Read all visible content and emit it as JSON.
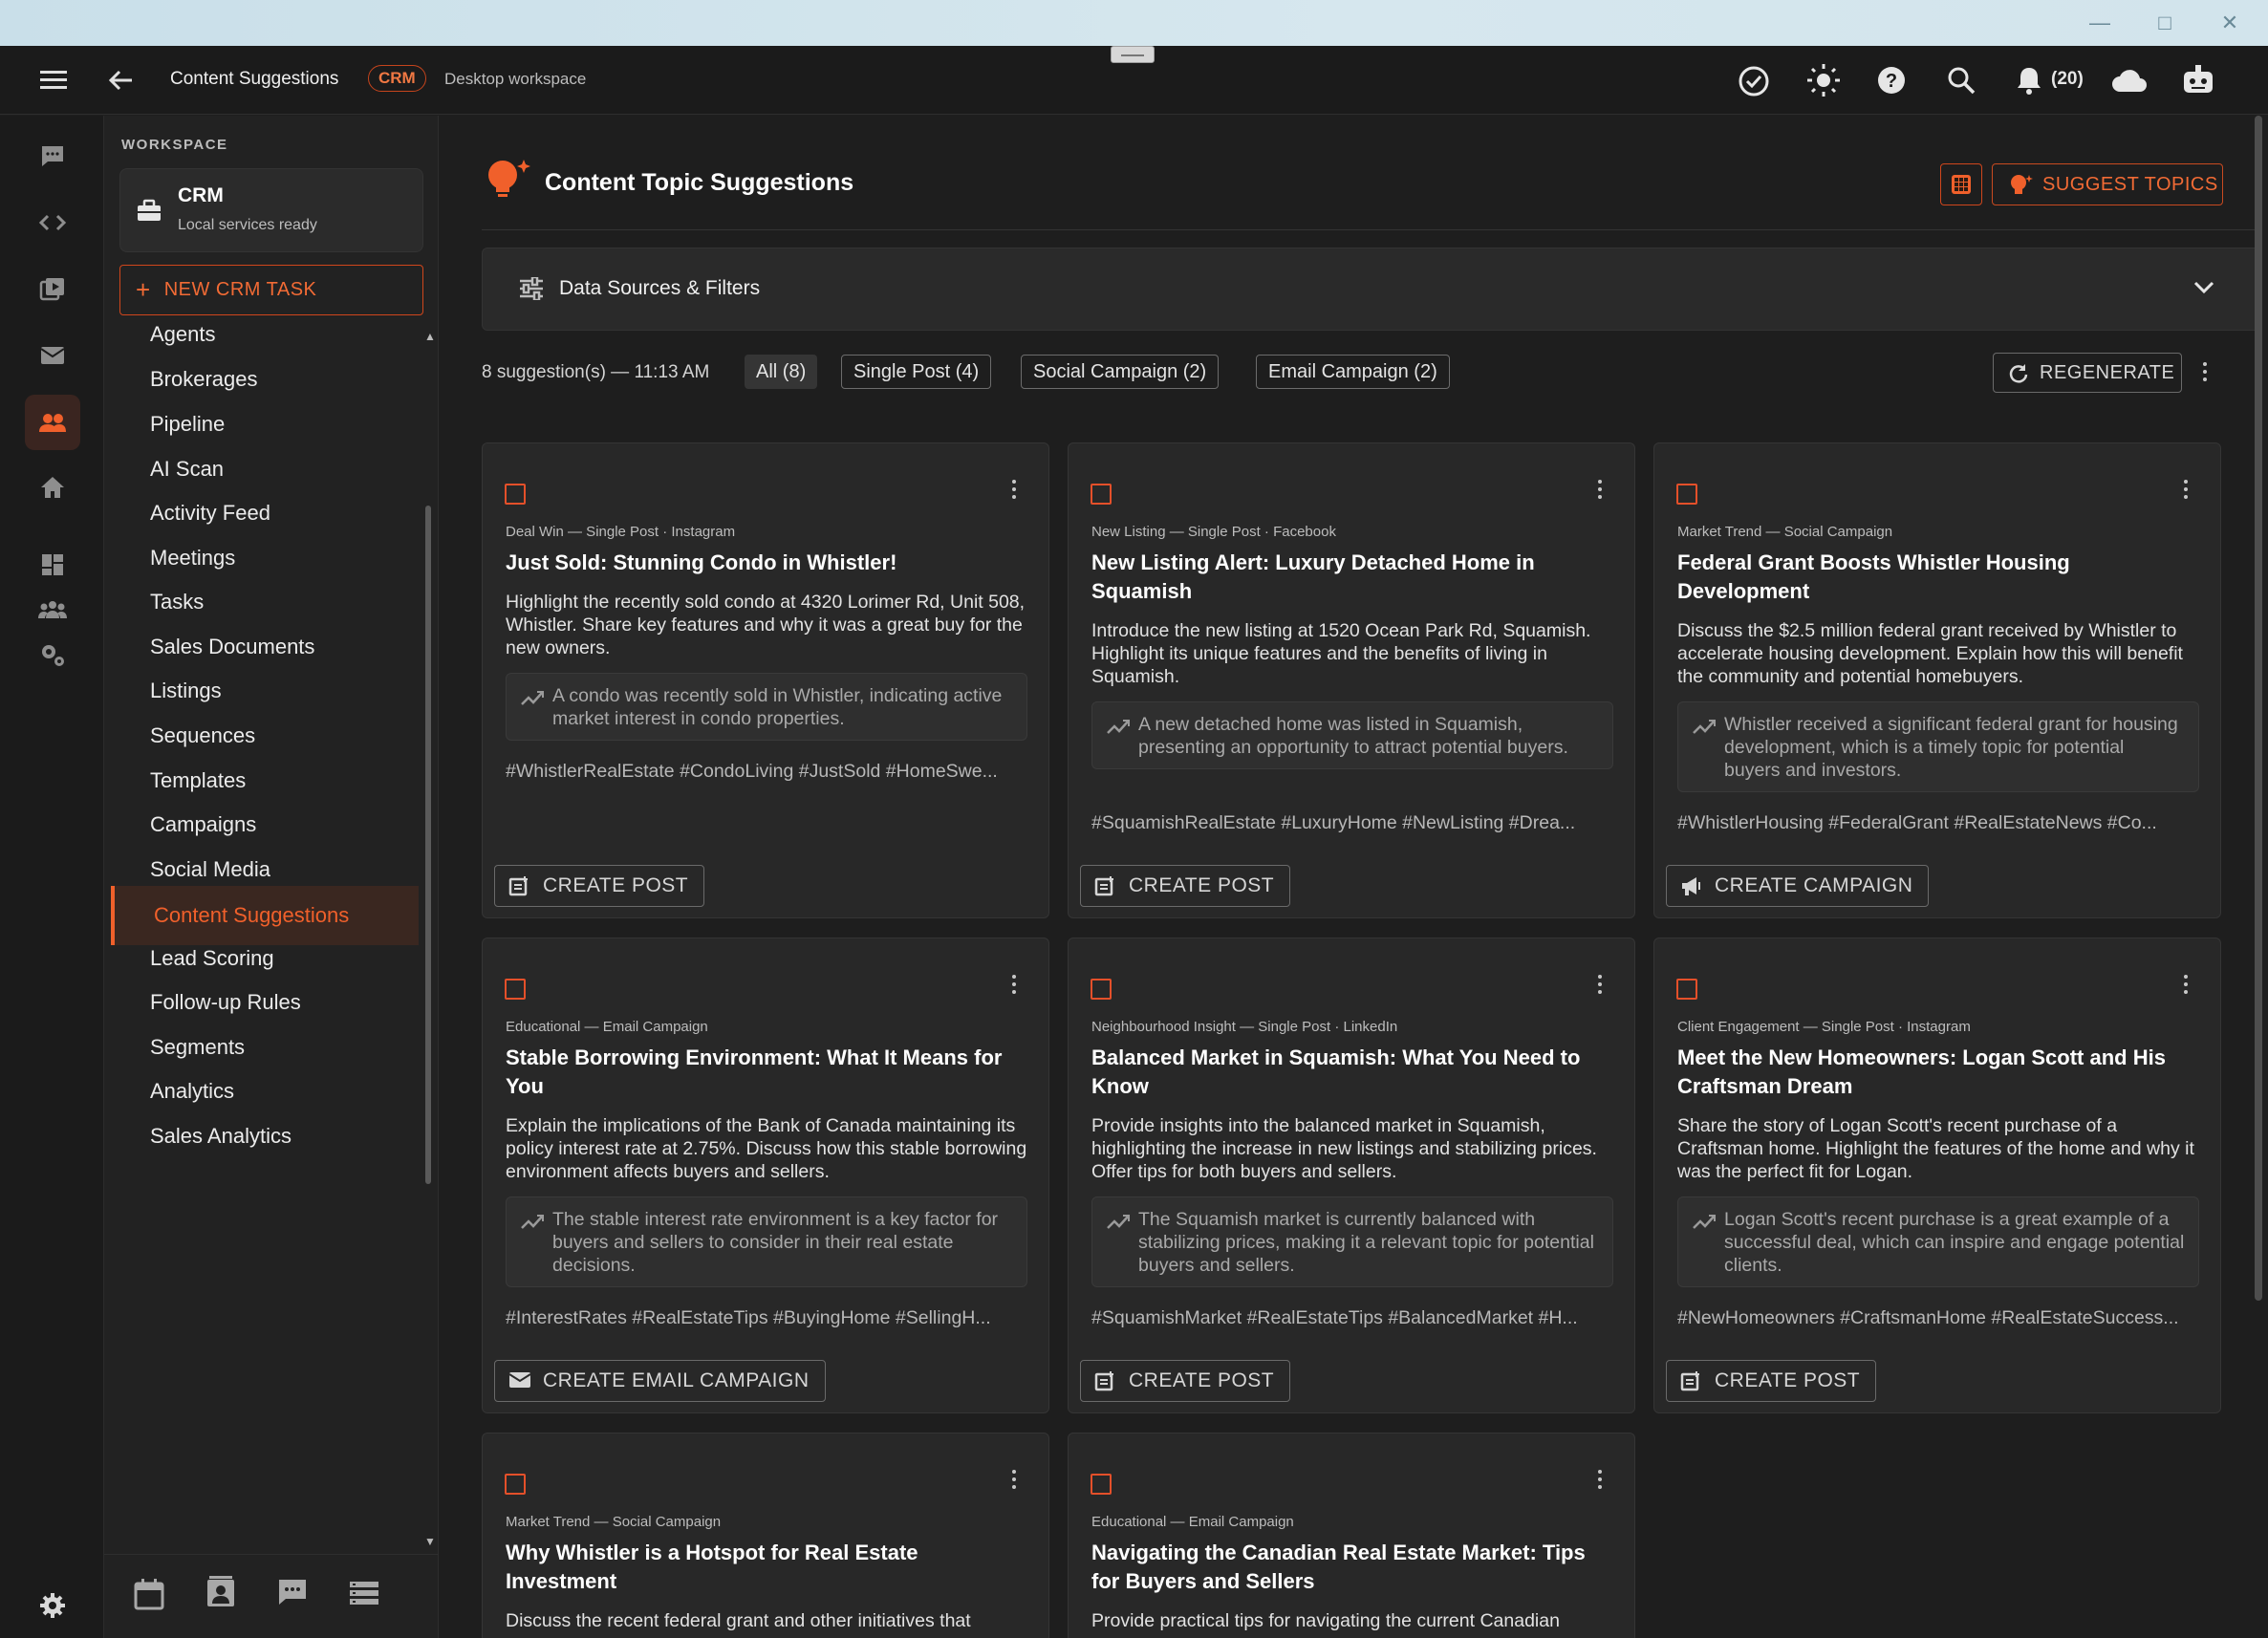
{
  "app": {
    "crumb_title": "Content Suggestions",
    "crumb_chip": "CRM",
    "crumb_sub": "Desktop workspace",
    "notification_count": "(20)"
  },
  "colors": {
    "accent": "#f0602b",
    "accent_border": "#d0461c",
    "bg": "#1e1e1e",
    "card": "#282828"
  },
  "workspace": {
    "label": "WORKSPACE",
    "name": "CRM",
    "status": "Local services ready",
    "new_task": "NEW CRM TASK"
  },
  "nav": {
    "items": [
      "Agents",
      "Brokerages",
      "Pipeline",
      "AI Scan",
      "Activity Feed",
      "Meetings",
      "Tasks",
      "Sales Documents",
      "Listings",
      "Sequences",
      "Templates",
      "Campaigns",
      "Social Media",
      "Content Suggestions",
      "Lead Scoring",
      "Follow-up Rules",
      "Segments",
      "Analytics",
      "Sales Analytics"
    ],
    "active": "Content Suggestions"
  },
  "page": {
    "title": "Content Topic Suggestions",
    "suggest_button": "SUGGEST TOPICS",
    "filters_label": "Data Sources & Filters",
    "meta": "8 suggestion(s) — 11:13 AM",
    "regenerate": "REGENERATE",
    "filter_chips": [
      "All (8)",
      "Single Post (4)",
      "Social Campaign (2)",
      "Email Campaign (2)"
    ]
  },
  "cards": [
    {
      "category": "Deal Win — Single Post · Instagram",
      "title": "Just Sold: Stunning Condo in Whistler!",
      "description": "Highlight the recently sold condo at 4320 Lorimer Rd, Unit 508, Whistler. Share key features and why it was a great buy for the new owners.",
      "insight": "A condo was recently sold in Whistler, indicating active market interest in condo properties.",
      "tags": "#WhistlerRealEstate #CondoLiving #JustSold #HomeSwe...",
      "action": "CREATE POST"
    },
    {
      "category": "New Listing — Single Post · Facebook",
      "title": "New Listing Alert: Luxury Detached Home in Squamish",
      "description": "Introduce the new listing at 1520 Ocean Park Rd, Squamish. Highlight its unique features and the benefits of living in Squamish.",
      "insight": "A new detached home was listed in Squamish, presenting an opportunity to attract potential buyers.",
      "tags": "#SquamishRealEstate #LuxuryHome #NewListing #Drea...",
      "action": "CREATE POST"
    },
    {
      "category": "Market Trend — Social Campaign",
      "title": "Federal Grant Boosts Whistler Housing Development",
      "description": "Discuss the $2.5 million federal grant received by Whistler to accelerate housing development. Explain how this will benefit the community and potential homebuyers.",
      "insight": "Whistler received a significant federal grant for housing development, which is a timely topic for potential buyers and investors.",
      "tags": "#WhistlerHousing #FederalGrant #RealEstateNews #Co...",
      "action": "CREATE CAMPAIGN"
    },
    {
      "category": "Educational — Email Campaign",
      "title": "Stable Borrowing Environment: What It Means for You",
      "description": "Explain the implications of the Bank of Canada maintaining its policy interest rate at 2.75%. Discuss how this stable borrowing environment affects buyers and sellers.",
      "insight": "The stable interest rate environment is a key factor for buyers and sellers to consider in their real estate decisions.",
      "tags": "#InterestRates #RealEstateTips #BuyingHome #SellingH...",
      "action": "CREATE EMAIL CAMPAIGN"
    },
    {
      "category": "Neighbourhood Insight — Single Post · LinkedIn",
      "title": "Balanced Market in Squamish: What You Need to Know",
      "description": "Provide insights into the balanced market in Squamish, highlighting the increase in new listings and stabilizing prices. Offer tips for both buyers and sellers.",
      "insight": "The Squamish market is currently balanced with stabilizing prices, making it a relevant topic for potential buyers and sellers.",
      "tags": "#SquamishMarket #RealEstateTips #BalancedMarket #H...",
      "action": "CREATE POST"
    },
    {
      "category": "Client Engagement — Single Post · Instagram",
      "title": "Meet the New Homeowners: Logan Scott and His Craftsman Dream",
      "description": "Share the story of Logan Scott's recent purchase of a Craftsman home. Highlight the features of the home and why it was the perfect fit for Logan.",
      "insight": "Logan Scott's recent purchase is a great example of a successful deal, which can inspire and engage potential clients.",
      "tags": "#NewHomeowners #CraftsmanHome #RealEstateSuccess...",
      "action": "CREATE POST"
    },
    {
      "category": "Market Trend — Social Campaign",
      "title": "Why Whistler is a Hotspot for Real Estate Investment",
      "description": "Discuss the recent federal grant and other initiatives that",
      "insight": "",
      "tags": "",
      "action": ""
    },
    {
      "category": "Educational — Email Campaign",
      "title": "Navigating the Canadian Real Estate Market: Tips for Buyers and Sellers",
      "description": "Provide practical tips for navigating the current Canadian",
      "insight": "",
      "tags": "",
      "action": ""
    }
  ]
}
